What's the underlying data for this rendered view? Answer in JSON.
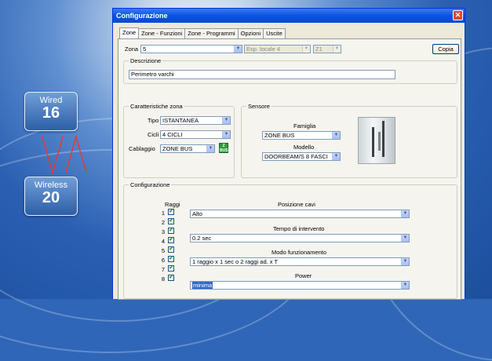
{
  "desktop": {
    "wired": {
      "label": "Wired",
      "count": "16"
    },
    "wireless": {
      "label": "Wireless",
      "count": "20"
    },
    "accent": "#2f66b8",
    "vline_color": "#e53935"
  },
  "window": {
    "title": "Configurazione",
    "close_glyph": "✕"
  },
  "tabs": [
    "Zone",
    "Zone - Funzioni",
    "Zone - Programmi",
    "Opzioni",
    "Uscite"
  ],
  "zone": {
    "label": "Zona",
    "value": "5",
    "expander": "Esp. locale 4",
    "input": "Z1",
    "copy_button": "Copia"
  },
  "descrizione": {
    "title": "Descrizione",
    "value": "Perimetro varchi"
  },
  "caratteristiche": {
    "title": "Caratteristiche zona",
    "tipo_label": "Tipo",
    "tipo_value": "ISTANTANEA",
    "cicli_label": "Cicli",
    "cicli_value": "4 CICLI",
    "cablaggio_label": "Cablaggio",
    "cablaggio_value": "ZONE BUS",
    "badge_top": "Z",
    "badge_bottom": "BUS"
  },
  "sensore": {
    "title": "Sensore",
    "famiglia_label": "Famiglia",
    "famiglia_value": "ZONE BUS",
    "modello_label": "Modello",
    "modello_value": "DOORBEAM/S 8 FASCI"
  },
  "configurazione": {
    "title": "Configurazione",
    "raggi_label": "Raggi",
    "raggi": [
      {
        "n": "1",
        "checked": true
      },
      {
        "n": "2",
        "checked": true
      },
      {
        "n": "3",
        "checked": true
      },
      {
        "n": "4",
        "checked": true
      },
      {
        "n": "5",
        "checked": true
      },
      {
        "n": "6",
        "checked": true
      },
      {
        "n": "7",
        "checked": true
      },
      {
        "n": "8",
        "checked": true
      }
    ],
    "check_glyph": "✔",
    "posizione_label": "Posizione cavi",
    "posizione_value": "Alto",
    "tempo_label": "Tempo di intervento",
    "tempo_value": "0.2 sec",
    "modo_label": "Modo funzionamento",
    "modo_value": "1 raggio x 1 sec o 2 raggi ad. x T",
    "power_label": "Power",
    "power_value": "minima"
  }
}
